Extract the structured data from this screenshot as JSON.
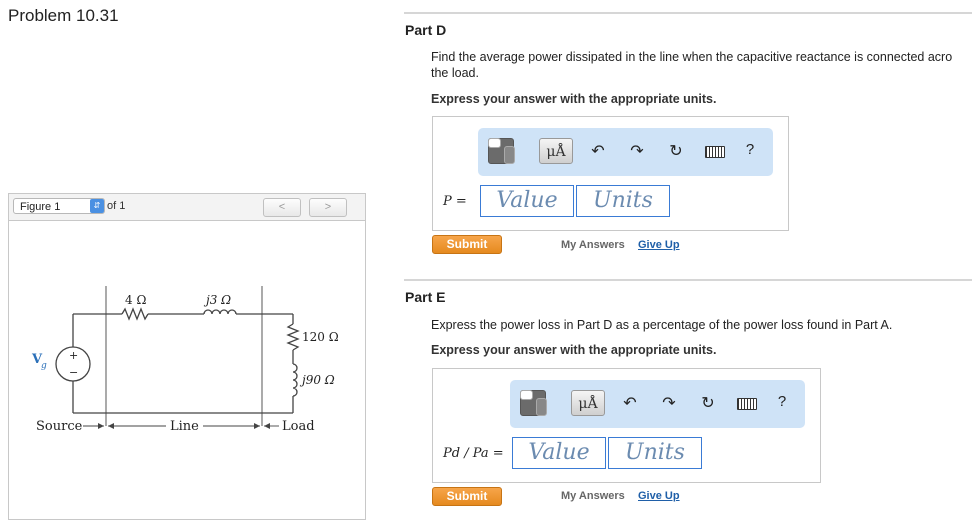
{
  "problem": {
    "title": "Problem 10.31"
  },
  "figure": {
    "select_value": "Figure 1",
    "of_label": "of 1",
    "prev_label": "<",
    "next_label": ">",
    "circuit": {
      "r_line": "4 Ω",
      "x_line": "j3 Ω",
      "r_load": "120 Ω",
      "x_load": "j90 Ω",
      "source_label": "V",
      "source_sub": "g",
      "plus": "+",
      "minus": "−",
      "source_text": "Source",
      "line_text": "Line",
      "load_text": "Load"
    }
  },
  "partD": {
    "title": "Part D",
    "prompt_line1": "Find the average power dissipated in the line when the capacitive reactance is connected acro",
    "prompt_line2": "the load.",
    "instruction": "Express your answer with the appropriate units.",
    "var_label": "P =",
    "value_placeholder": "Value",
    "units_placeholder": "Units",
    "units_btn": "μÅ",
    "help": "?",
    "submit": "Submit",
    "my_answers": "My Answers",
    "give_up": "Give Up"
  },
  "partE": {
    "title": "Part E",
    "prompt": "Express the power loss in Part D as a percentage of the power loss found in Part A.",
    "instruction": "Express your answer with the appropriate units.",
    "var_label": "Pd / Pa =",
    "value_placeholder": "Value",
    "units_placeholder": "Units",
    "units_btn": "μÅ",
    "help": "?",
    "submit": "Submit",
    "my_answers": "My Answers",
    "give_up": "Give Up"
  },
  "colors": {
    "accent": "#e58a1f",
    "link": "#1f5fa8",
    "toolbar_bg": "#cfe3f7",
    "input_border": "#3a7bd5"
  }
}
